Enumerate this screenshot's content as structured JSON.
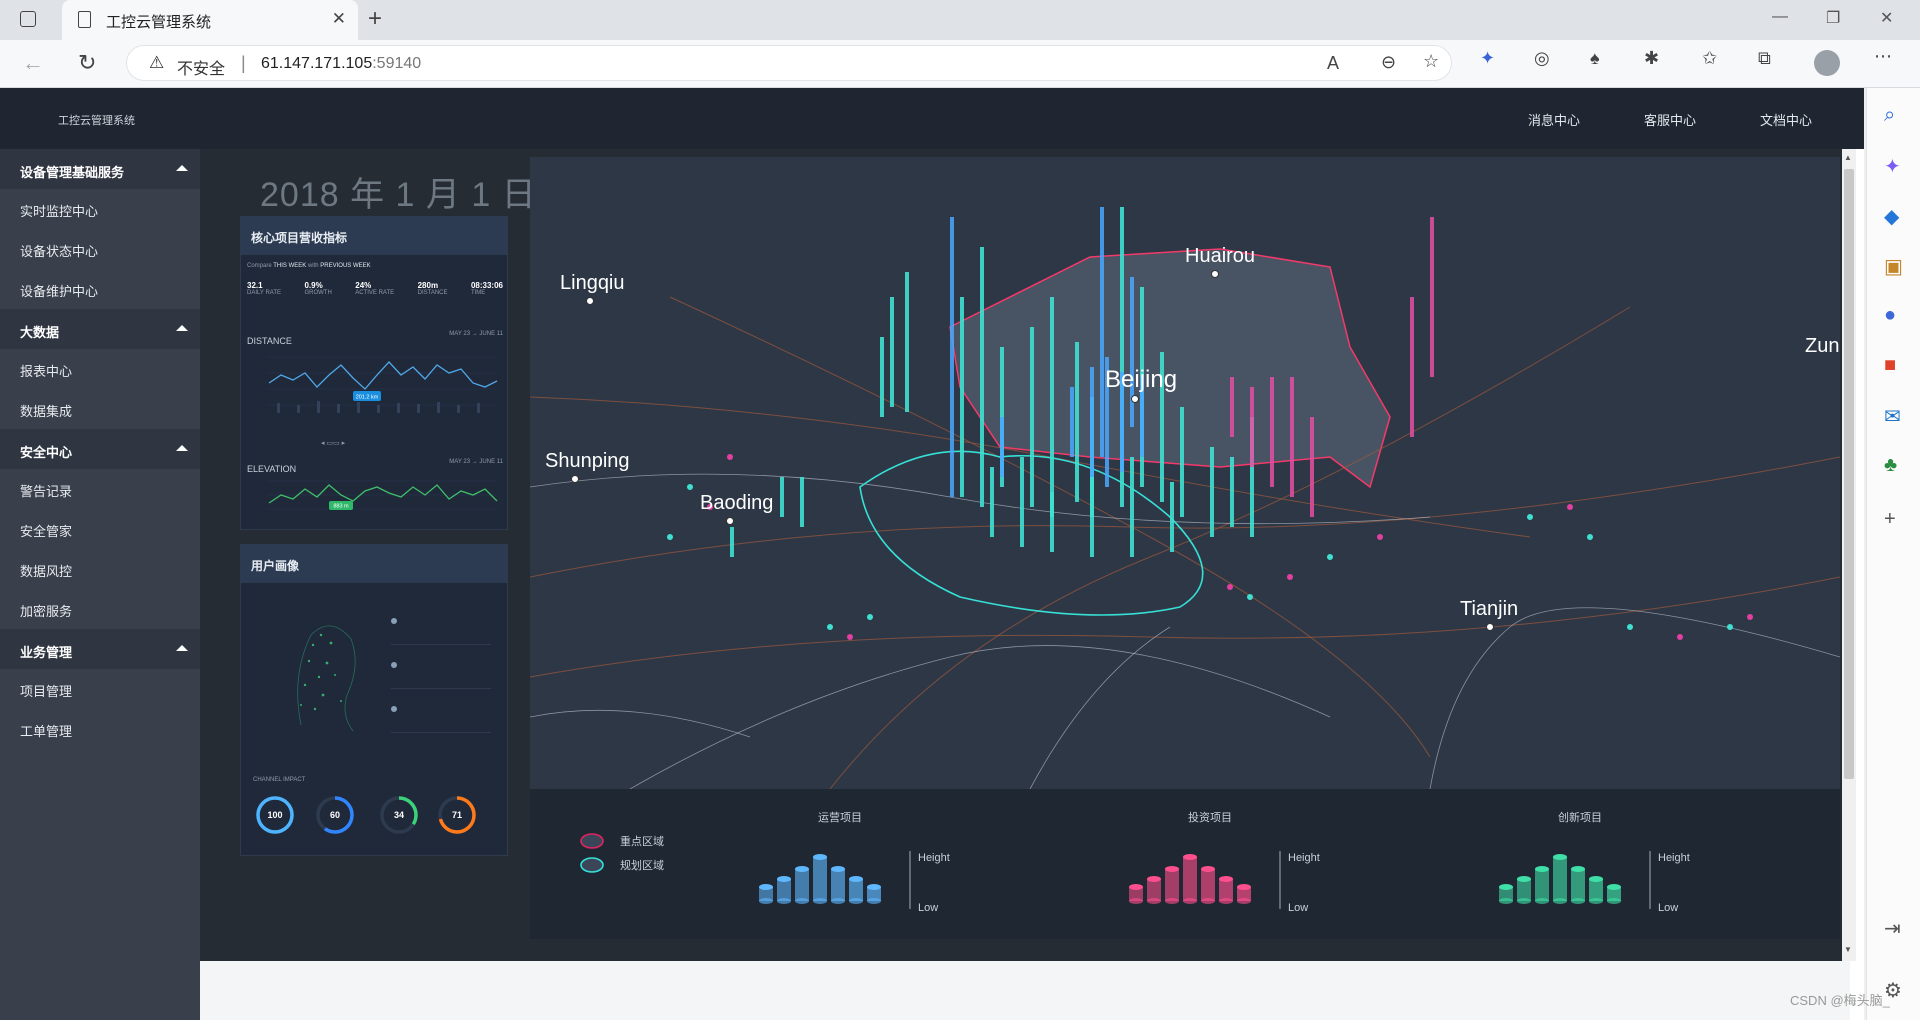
{
  "browser": {
    "tab_title": "工控云管理系统",
    "security_label": "不安全",
    "url_host": "61.147.171.105",
    "url_port": ":59140"
  },
  "app": {
    "brand": "工控云管理系统",
    "top_nav": [
      "消息中心",
      "客服中心",
      "文档中心"
    ]
  },
  "sidebar": {
    "groups": [
      {
        "title": "设备管理基础服务",
        "items": [
          "实时监控中心",
          "设备状态中心",
          "设备维护中心"
        ]
      },
      {
        "title": "大数据",
        "items": [
          "报表中心",
          "数据集成"
        ]
      },
      {
        "title": "安全中心",
        "items": [
          "警告记录",
          "安全管家",
          "数据风控",
          "加密服务"
        ]
      },
      {
        "title": "业务管理",
        "items": [
          "项目管理",
          "工单管理"
        ]
      }
    ]
  },
  "dashboard": {
    "date": "2018 年 1 月 1 日",
    "kpi_panel": {
      "title": "核心项目营收指标",
      "compare_label": "Compare",
      "this_week": "THIS WEEK",
      "with": "with",
      "previous_week": "PREVIOUS WEEK",
      "stats": [
        {
          "value": "32.1",
          "label": "DAILY RATE"
        },
        {
          "value": "0.9%",
          "label": "GROWTH"
        },
        {
          "value": "24%",
          "label": "ACTIVE RATE"
        },
        {
          "value": "280m",
          "label": "DISTANCE"
        },
        {
          "value": "08:33:06",
          "label": "TIME"
        }
      ],
      "distance_title": "DISTANCE",
      "distance_from": "MAY 23",
      "distance_to": "JUNE 11",
      "distance_badge": "201.2 km",
      "elevation_title": "ELEVATION",
      "elevation_badge": "883 m"
    },
    "user_panel": {
      "title": "用户画像",
      "channel_label": "CHANNEL IMPACT",
      "gauges": [
        {
          "value": "100",
          "pct": 1.0,
          "color": "#4fb4ff"
        },
        {
          "value": "60",
          "pct": 0.6,
          "color": "#2f86ff"
        },
        {
          "value": "34",
          "pct": 0.34,
          "color": "#3ad27a"
        },
        {
          "value": "71",
          "pct": 0.71,
          "color": "#ff7a1a"
        }
      ]
    },
    "map": {
      "cities": [
        "Lingqiu",
        "Huairou",
        "Beijing",
        "Shunping",
        "Baoding",
        "Tianjin",
        "Zun"
      ]
    },
    "legend": {
      "items": [
        {
          "label": "重点区域",
          "color": "#e0245e"
        },
        {
          "label": "规划区域",
          "color": "#37e0d6"
        }
      ],
      "groups": [
        {
          "title": "运营项目",
          "color": "#5fb8ff"
        },
        {
          "title": "投资项目",
          "color": "#ff4f8d"
        },
        {
          "title": "创新项目",
          "color": "#3fe0a7"
        }
      ],
      "high": "Height",
      "low": "Low"
    }
  },
  "watermark": "CSDN @梅头脑_"
}
